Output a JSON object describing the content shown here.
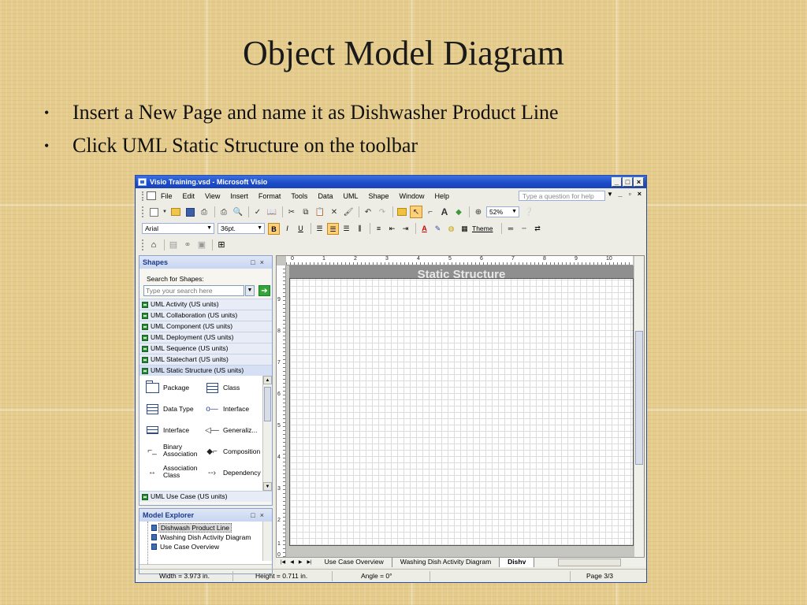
{
  "slide": {
    "title": "Object Model Diagram",
    "bullets": [
      "Insert a New Page and name it as Dishwasher Product Line",
      "Click UML Static Structure on the toolbar"
    ]
  },
  "window": {
    "title": "Visio Training.vsd - Microsoft Visio",
    "menu": [
      "File",
      "Edit",
      "View",
      "Insert",
      "Format",
      "Tools",
      "Data",
      "UML",
      "Shape",
      "Window",
      "Help"
    ],
    "help_placeholder": "Type a question for help",
    "zoom": "52%",
    "font": "Arial",
    "font_size": "36pt.",
    "theme_label": "Theme"
  },
  "shapes_pane": {
    "title": "Shapes",
    "search_label": "Search for Shapes:",
    "search_placeholder": "Type your search here",
    "stencils": [
      "UML Activity (US units)",
      "UML Collaboration (US units)",
      "UML Component (US units)",
      "UML Deployment (US units)",
      "UML Sequence (US units)",
      "UML Statechart (US units)",
      "UML Static Structure (US units)"
    ],
    "shapes": [
      "Package",
      "Class",
      "Data Type",
      "Interface",
      "Interface",
      "Generaliz...",
      "Binary Association",
      "Composition",
      "Association Class",
      "Dependency"
    ],
    "bottom_stencil": "UML Use Case (US units)"
  },
  "model_explorer": {
    "title": "Model Explorer",
    "items": [
      "Dishwash Product Line",
      "Washing Dish Activity Diagram",
      "Use Case Overview"
    ]
  },
  "drawing": {
    "banner": "Static Structure",
    "ruler_top": [
      "0",
      "1",
      "2",
      "3",
      "4",
      "5",
      "6",
      "7",
      "8",
      "9",
      "10"
    ],
    "ruler_left": [
      "9",
      "8",
      "7",
      "6",
      "5",
      "4",
      "3",
      "2",
      "1",
      "0"
    ],
    "tabs": [
      "Use Case Overview",
      "Washing Dish Activity Diagram",
      "Dishv"
    ]
  },
  "status": {
    "width": "Width = 3.973 in.",
    "height": "Height = 0.711 in.",
    "angle": "Angle = 0°",
    "page": "Page 3/3"
  }
}
